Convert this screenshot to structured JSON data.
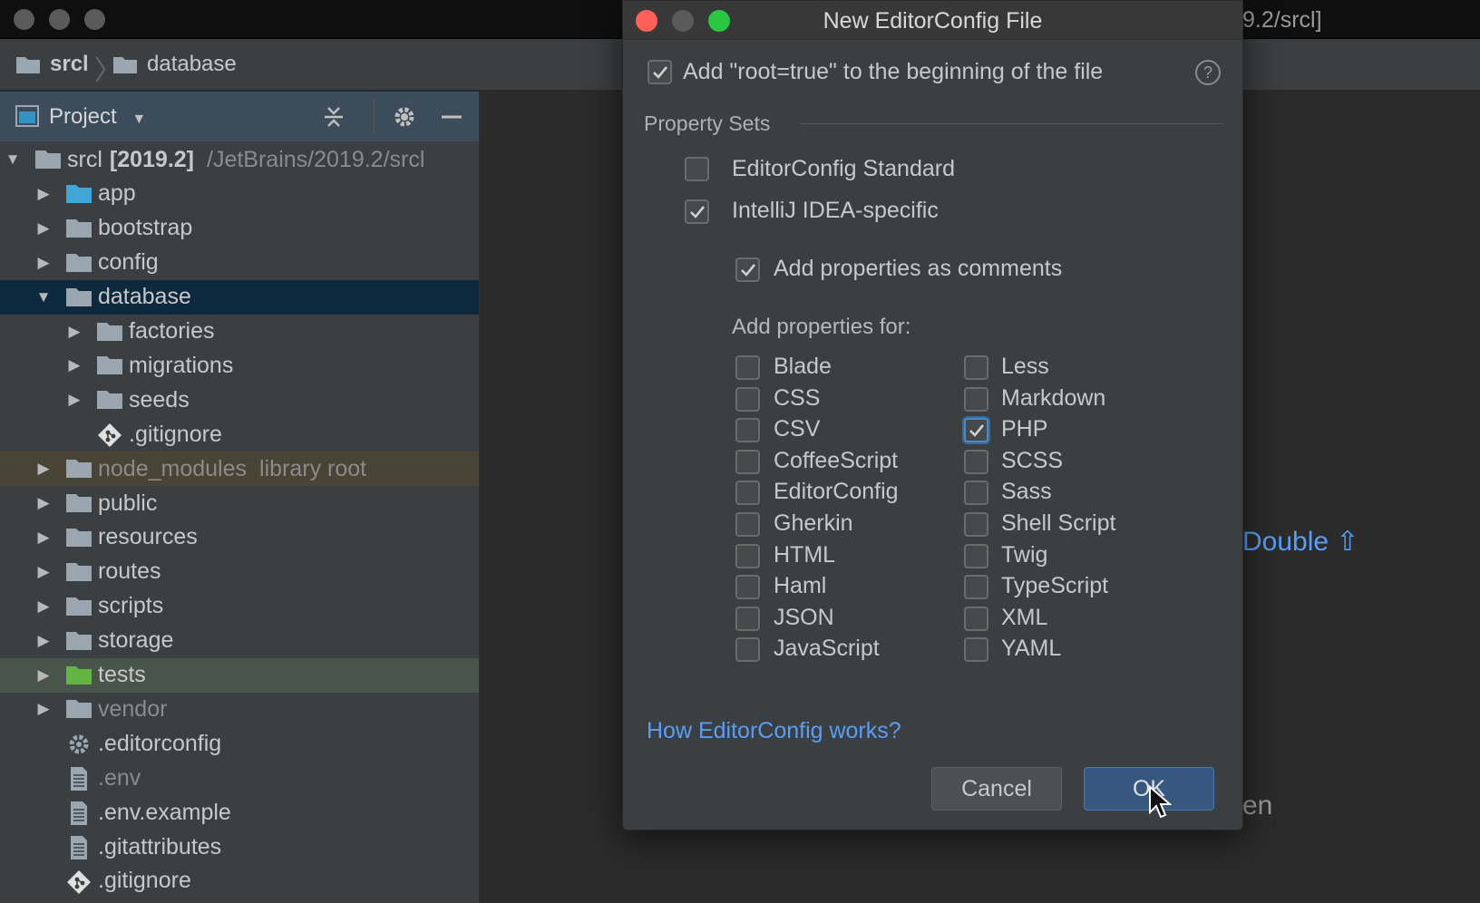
{
  "window": {
    "title_fragment": "9.2/srcl]"
  },
  "breadcrumb": {
    "items": [
      "srcl",
      "database"
    ],
    "separator": "〉"
  },
  "project_panel": {
    "title": "Project",
    "dropdown_glyph": "▼",
    "rows": [
      {
        "label": "srcl",
        "bold_suffix": "[2019.2]",
        "path": "/JetBrains/2019.2/srcl",
        "expanded": true,
        "icon": "folder-icon"
      },
      {
        "label": "app",
        "expanded": false,
        "icon": "folder-blue-icon"
      },
      {
        "label": "bootstrap",
        "expanded": false,
        "icon": "folder-icon"
      },
      {
        "label": "config",
        "expanded": false,
        "icon": "folder-icon"
      },
      {
        "label": "database",
        "expanded": true,
        "icon": "folder-icon",
        "selected": true
      },
      {
        "label": "factories",
        "expanded": false,
        "icon": "folder-icon"
      },
      {
        "label": "migrations",
        "expanded": false,
        "icon": "folder-icon"
      },
      {
        "label": "seeds",
        "expanded": false,
        "icon": "folder-icon"
      },
      {
        "label": ".gitignore",
        "icon": "git-file-icon"
      },
      {
        "label": "node_modules",
        "suffix": "library root",
        "expanded": false,
        "icon": "folder-icon"
      },
      {
        "label": "public",
        "expanded": false,
        "icon": "folder-icon"
      },
      {
        "label": "resources",
        "expanded": false,
        "icon": "folder-icon"
      },
      {
        "label": "routes",
        "expanded": false,
        "icon": "folder-icon"
      },
      {
        "label": "scripts",
        "expanded": false,
        "icon": "folder-icon"
      },
      {
        "label": "storage",
        "expanded": false,
        "icon": "folder-icon"
      },
      {
        "label": "tests",
        "expanded": false,
        "icon": "folder-green-icon"
      },
      {
        "label": "vendor",
        "expanded": false,
        "icon": "folder-icon"
      },
      {
        "label": ".editorconfig",
        "icon": "gear-file-icon"
      },
      {
        "label": ".env",
        "icon": "text-file-icon"
      },
      {
        "label": ".env.example",
        "icon": "text-file-icon"
      },
      {
        "label": ".gitattributes",
        "icon": "text-file-icon"
      },
      {
        "label": ".gitignore",
        "icon": "git-file-icon"
      }
    ]
  },
  "editor": {
    "hint_fragment": "Double ⇧",
    "text_fragment": "en"
  },
  "dialog": {
    "title": "New EditorConfig File",
    "root_true": {
      "label": "Add \"root=true\" to the beginning of the file",
      "checked": true
    },
    "help_glyph": "?",
    "property_sets_label": "Property Sets",
    "editorconfig_standard": {
      "label": "EditorConfig Standard",
      "checked": false
    },
    "intellij_specific": {
      "label": "IntelliJ IDEA-specific",
      "checked": true
    },
    "add_comments": {
      "label": "Add properties as comments",
      "checked": true
    },
    "add_properties_for": "Add properties for:",
    "languages_left": [
      {
        "label": "Blade",
        "checked": false
      },
      {
        "label": "CSS",
        "checked": false
      },
      {
        "label": "CSV",
        "checked": false
      },
      {
        "label": "CoffeeScript",
        "checked": false
      },
      {
        "label": "EditorConfig",
        "checked": false
      },
      {
        "label": "Gherkin",
        "checked": false
      },
      {
        "label": "HTML",
        "checked": false
      },
      {
        "label": "Haml",
        "checked": false
      },
      {
        "label": "JSON",
        "checked": false
      },
      {
        "label": "JavaScript",
        "checked": false
      }
    ],
    "languages_right": [
      {
        "label": "Less",
        "checked": false
      },
      {
        "label": "Markdown",
        "checked": false
      },
      {
        "label": "PHP",
        "checked": true,
        "focused": true
      },
      {
        "label": "SCSS",
        "checked": false
      },
      {
        "label": "Sass",
        "checked": false
      },
      {
        "label": "Shell Script",
        "checked": false
      },
      {
        "label": "Twig",
        "checked": false
      },
      {
        "label": "TypeScript",
        "checked": false
      },
      {
        "label": "XML",
        "checked": false
      },
      {
        "label": "YAML",
        "checked": false
      }
    ],
    "help_link": "How EditorConfig works?",
    "cancel_label": "Cancel",
    "ok_label": "OK"
  },
  "colors": {
    "link": "#589df6",
    "selection": "#0d293e",
    "ok_button": "#365880",
    "traffic_red": "#ff5f57",
    "traffic_green": "#28c840"
  }
}
